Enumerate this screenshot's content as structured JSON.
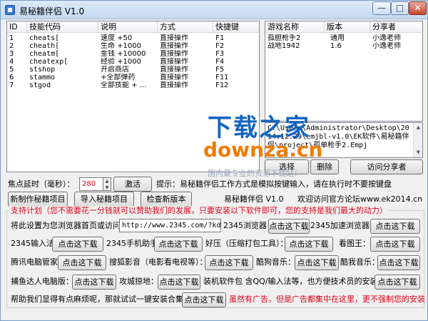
{
  "window": {
    "title": "易秘籍伴侣 V1.0",
    "min": "—",
    "max": "□",
    "close": "✕"
  },
  "left_table": {
    "headers": [
      "ID",
      "技能代码",
      "说明",
      "方式",
      "快捷键"
    ],
    "rows": [
      {
        "id": "1",
        "code": "cheats[",
        "desc": "速度 +50",
        "mode": "直接操作",
        "key": "F1"
      },
      {
        "id": "2",
        "code": "cheath[",
        "desc": "生命 +1000",
        "mode": "直接操作",
        "key": "F2"
      },
      {
        "id": "3",
        "code": "cheatm[",
        "desc": "金钱 +10000",
        "mode": "直接操作",
        "key": "F3"
      },
      {
        "id": "4",
        "code": "cheatexp[",
        "desc": "经验 +1000",
        "mode": "直接操作",
        "key": "F4"
      },
      {
        "id": "5",
        "code": "stshop",
        "desc": "开启商店",
        "mode": "直接操作",
        "key": "F5"
      },
      {
        "id": "6",
        "code": "stammo",
        "desc": "+全部弹药",
        "mode": "直接操作",
        "key": "F11"
      },
      {
        "id": "7",
        "code": "stgod",
        "desc": "全部技能 + ...",
        "mode": "直接操作",
        "key": "F12"
      }
    ]
  },
  "right_table": {
    "headers": [
      "游戏名称",
      "版本",
      "分享者"
    ],
    "rows": [
      {
        "name": "孤胆枪手2",
        "version": "通用",
        "sharer": "小逸老师"
      },
      {
        "name": "战地1942",
        "version": "1.6",
        "sharer": "小逸老师"
      }
    ]
  },
  "path_box": {
    "text": "C:\\Users\\Administrator\\Desktop\\2014.12.29\\emjbl-v1.0\\EK软件\\易秘籍伴侣\\project\\孤单枪手2.Empj"
  },
  "right_buttons": {
    "select": "选择",
    "delete": "删除",
    "visit": "访问分享者"
  },
  "watermark": {
    "top": "下载之家",
    "bottom": "downza.cn",
    "slogan": "国内最专业的资源下载站！"
  },
  "delay": {
    "label": "焦点延时（毫秒）：",
    "value": "280",
    "activate": "激活"
  },
  "hint": "提示：易秘籍伴侣工作方式是模拟按键输入，请在执行时不要按键盘",
  "project_buttons": {
    "new": "新制作秘籍项目",
    "import": "导入秘籍项目",
    "update": "检查新版本"
  },
  "version_text": "易秘籍伴侣 V1.0",
  "forum_text": "欢迎访问官方论坛www.ek2014.cn",
  "support": {
    "header": "支持计划（您不需要花一分钱就可以赞助我们的发展，只要安装以下软件即可，您的支持是我们最大的动力）",
    "homepage_label": "将此设置为您浏览器首页或访问:",
    "homepage_url": "http://www.2345.com/?kdreg",
    "download": "点击这下载",
    "rows": [
      [
        "2345浏览器：",
        "2345加速浏览器："
      ],
      [
        "2345输入法：",
        "2345手机助手：",
        "好压（压缩打包工具）：",
        "看图王："
      ],
      [
        "腾讯电脑管家：",
        "搜狐影音（电影看电视等）：",
        "酷狗音乐：",
        "酷我音乐："
      ],
      [
        "捕鱼达人电脑版：",
        "攻城掠地：",
        "装机软件包 含QQ/输入法等，也方便技术员的安装）"
      ]
    ],
    "last_label": "帮助我们显得有点麻烦呢，那就试试一键安装合集：",
    "ad_note": "虽然有广告，但是广告都集中在这里，更不强制您的安装"
  },
  "colors": {
    "accent_red": "#e0001b",
    "watermark_blue": "#1565c0",
    "watermark_orange": "#f07c00"
  }
}
